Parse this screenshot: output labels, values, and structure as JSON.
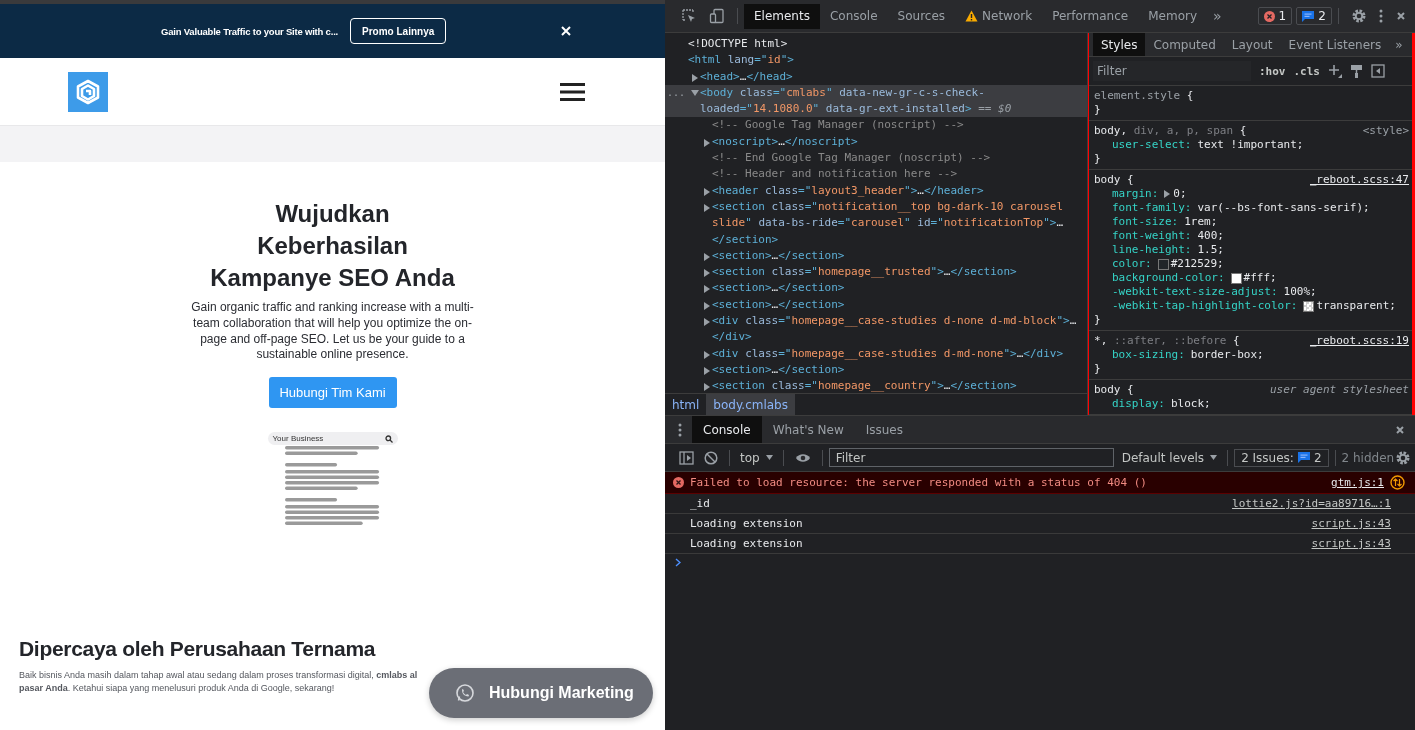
{
  "page": {
    "promo_bar": {
      "text": "Gain Valuable Traffic to your Site with c...",
      "button": "Promo Lainnya"
    },
    "hero": {
      "title_lines": [
        "Wujudkan",
        "Keberhasilan",
        "Kampanye SEO Anda"
      ],
      "description": "Gain organic traffic and ranking increase with a multi-team collaboration that will help you optimize the on-page and off-page SEO. Let us be your guide to a sustainable online presence.",
      "button": "Hubungi Tim Kami",
      "mock_search": "Your Business"
    },
    "trusted": {
      "heading": "Dipercaya oleh Perusahaan Ternama",
      "lines": [
        "Baik bisnis Anda masih dalam tahap awal atau sedang dalam proses transformasi digital, **cmlabs al**",
        "**pasar Anda**. Ketahui siapa yang menelusuri produk Anda di Google, sekarang!"
      ]
    },
    "float_button": "Hubungi Marketing"
  },
  "devtools": {
    "tabs": [
      {
        "label": "Elements",
        "selected": true,
        "warning": false
      },
      {
        "label": "Console",
        "selected": false,
        "warning": false
      },
      {
        "label": "Sources",
        "selected": false,
        "warning": false
      },
      {
        "label": "Network",
        "selected": false,
        "warning": true
      },
      {
        "label": "Performance",
        "selected": false,
        "warning": false
      },
      {
        "label": "Memory",
        "selected": false,
        "warning": false
      }
    ],
    "more_tabs": "»",
    "errors": "1",
    "messages": "2",
    "elements": {
      "tree": [
        {
          "selected": false,
          "segments": [
            {
              "kind": "plain",
              "text": "<!DOCTYPE html>"
            }
          ]
        },
        {
          "selected": false,
          "segments": [
            {
              "kind": "tag",
              "text": "<html "
            },
            {
              "kind": "attr",
              "text": "lang"
            },
            {
              "kind": "tag",
              "text": "=\""
            },
            {
              "kind": "value",
              "text": "id"
            },
            {
              "kind": "tag",
              "text": "\">"
            }
          ],
          "children": [
            {
              "selected": false,
              "expanded": false,
              "segments": [
                {
                  "kind": "tag",
                  "text": "<head>"
                },
                {
                  "kind": "plain",
                  "text": "…"
                },
                {
                  "kind": "tag",
                  "text": "</head>"
                }
              ]
            },
            {
              "selected": true,
              "expanded": true,
              "gutter": "...",
              "segments": [
                {
                  "kind": "tag",
                  "text": "<body "
                },
                {
                  "kind": "attr",
                  "text": "class"
                },
                {
                  "kind": "tag",
                  "text": "=\""
                },
                {
                  "kind": "value",
                  "text": "cmlabs"
                },
                {
                  "kind": "tag",
                  "text": "\" "
                },
                {
                  "kind": "attr",
                  "text": "data-new-gr-c-s-check-loaded"
                },
                {
                  "kind": "tag",
                  "text": "=\""
                },
                {
                  "kind": "value",
                  "text": "14.1080.0"
                },
                {
                  "kind": "tag",
                  "text": "\" "
                },
                {
                  "kind": "attr",
                  "text": "data-gr-ext-installed"
                },
                {
                  "kind": "tag",
                  "text": ">"
                },
                {
                  "kind": "hint",
                  "text": " == $0"
                }
              ],
              "children": [
                {
                  "selected": false,
                  "segments": [
                    {
                      "kind": "comment",
                      "text": "<!-- Google Tag Manager (noscript) -->"
                    }
                  ]
                },
                {
                  "selected": false,
                  "expanded": false,
                  "segments": [
                    {
                      "kind": "tag",
                      "text": "<noscript>"
                    },
                    {
                      "kind": "plain",
                      "text": "…"
                    },
                    {
                      "kind": "tag",
                      "text": "</noscript>"
                    }
                  ]
                },
                {
                  "selected": false,
                  "segments": [
                    {
                      "kind": "comment",
                      "text": "<!-- End Google Tag Manager (noscript) -->"
                    }
                  ]
                },
                {
                  "selected": false,
                  "segments": [
                    {
                      "kind": "comment",
                      "text": "<!-- Header and notification here -->"
                    }
                  ]
                },
                {
                  "selected": false,
                  "expanded": false,
                  "segments": [
                    {
                      "kind": "tag",
                      "text": "<header "
                    },
                    {
                      "kind": "attr",
                      "text": "class"
                    },
                    {
                      "kind": "tag",
                      "text": "=\""
                    },
                    {
                      "kind": "value",
                      "text": "layout3_header"
                    },
                    {
                      "kind": "tag",
                      "text": "\">"
                    },
                    {
                      "kind": "plain",
                      "text": "…"
                    },
                    {
                      "kind": "tag",
                      "text": "</header>"
                    }
                  ]
                },
                {
                  "selected": false,
                  "expanded": false,
                  "segments": [
                    {
                      "kind": "tag",
                      "text": "<section "
                    },
                    {
                      "kind": "attr",
                      "text": "class"
                    },
                    {
                      "kind": "tag",
                      "text": "=\""
                    },
                    {
                      "kind": "value",
                      "text": "notification__top bg-dark-10 carousel slide"
                    },
                    {
                      "kind": "tag",
                      "text": "\" "
                    },
                    {
                      "kind": "attr",
                      "text": "data-bs-ride"
                    },
                    {
                      "kind": "tag",
                      "text": "=\""
                    },
                    {
                      "kind": "value",
                      "text": "carousel"
                    },
                    {
                      "kind": "tag",
                      "text": "\" "
                    },
                    {
                      "kind": "attr",
                      "text": "id"
                    },
                    {
                      "kind": "tag",
                      "text": "=\""
                    },
                    {
                      "kind": "value",
                      "text": "notificationTop"
                    },
                    {
                      "kind": "tag",
                      "text": "\">"
                    },
                    {
                      "kind": "plain",
                      "text": "… "
                    },
                    {
                      "kind": "tag",
                      "text": "</section>"
                    }
                  ]
                },
                {
                  "selected": false,
                  "expanded": false,
                  "segments": [
                    {
                      "kind": "tag",
                      "text": "<section>"
                    },
                    {
                      "kind": "plain",
                      "text": "…"
                    },
                    {
                      "kind": "tag",
                      "text": "</section>"
                    }
                  ]
                },
                {
                  "selected": false,
                  "expanded": false,
                  "segments": [
                    {
                      "kind": "tag",
                      "text": "<section "
                    },
                    {
                      "kind": "attr",
                      "text": "class"
                    },
                    {
                      "kind": "tag",
                      "text": "=\""
                    },
                    {
                      "kind": "value",
                      "text": "homepage__trusted"
                    },
                    {
                      "kind": "tag",
                      "text": "\">"
                    },
                    {
                      "kind": "plain",
                      "text": "…"
                    },
                    {
                      "kind": "tag",
                      "text": "</section>"
                    }
                  ]
                },
                {
                  "selected": false,
                  "expanded": false,
                  "segments": [
                    {
                      "kind": "tag",
                      "text": "<section>"
                    },
                    {
                      "kind": "plain",
                      "text": "…"
                    },
                    {
                      "kind": "tag",
                      "text": "</section>"
                    }
                  ]
                },
                {
                  "selected": false,
                  "expanded": false,
                  "segments": [
                    {
                      "kind": "tag",
                      "text": "<section>"
                    },
                    {
                      "kind": "plain",
                      "text": "…"
                    },
                    {
                      "kind": "tag",
                      "text": "</section>"
                    }
                  ]
                },
                {
                  "selected": false,
                  "expanded": false,
                  "segments": [
                    {
                      "kind": "tag",
                      "text": "<div "
                    },
                    {
                      "kind": "attr",
                      "text": "class"
                    },
                    {
                      "kind": "tag",
                      "text": "=\""
                    },
                    {
                      "kind": "value",
                      "text": "homepage__case-studies d-none d-md-block"
                    },
                    {
                      "kind": "tag",
                      "text": "\">"
                    },
                    {
                      "kind": "plain",
                      "text": "… "
                    },
                    {
                      "kind": "tag",
                      "text": "</div>"
                    }
                  ]
                },
                {
                  "selected": false,
                  "expanded": false,
                  "segments": [
                    {
                      "kind": "tag",
                      "text": "<div "
                    },
                    {
                      "kind": "attr",
                      "text": "class"
                    },
                    {
                      "kind": "tag",
                      "text": "=\""
                    },
                    {
                      "kind": "value",
                      "text": "homepage__case-studies d-md-none"
                    },
                    {
                      "kind": "tag",
                      "text": "\">"
                    },
                    {
                      "kind": "plain",
                      "text": "…"
                    },
                    {
                      "kind": "tag",
                      "text": "</div>"
                    }
                  ]
                },
                {
                  "selected": false,
                  "expanded": false,
                  "segments": [
                    {
                      "kind": "tag",
                      "text": "<section>"
                    },
                    {
                      "kind": "plain",
                      "text": "…"
                    },
                    {
                      "kind": "tag",
                      "text": "</section>"
                    }
                  ]
                },
                {
                  "selected": false,
                  "expanded": false,
                  "segments": [
                    {
                      "kind": "tag",
                      "text": "<section "
                    },
                    {
                      "kind": "attr",
                      "text": "class"
                    },
                    {
                      "kind": "tag",
                      "text": "=\""
                    },
                    {
                      "kind": "value",
                      "text": "homepage__country"
                    },
                    {
                      "kind": "tag",
                      "text": "\">"
                    },
                    {
                      "kind": "plain",
                      "text": "…"
                    },
                    {
                      "kind": "tag",
                      "text": "</section>"
                    }
                  ]
                }
              ]
            }
          ]
        }
      ],
      "breadcrumbs": [
        {
          "label": "html",
          "selected": false
        },
        {
          "label": "body.cmlabs",
          "selected": true
        }
      ]
    },
    "styles": {
      "highlighted": true,
      "tabs": [
        {
          "label": "Styles",
          "selected": true
        },
        {
          "label": "Computed",
          "selected": false
        },
        {
          "label": "Layout",
          "selected": false
        },
        {
          "label": "Event Listeners",
          "selected": false
        }
      ],
      "more_tabs": "»",
      "filter_placeholder": "Filter",
      "hov": ":hov",
      "cls": ".cls",
      "rules": [
        {
          "selector": [
            {
              "kind": "dim",
              "text": "element.style"
            },
            {
              "kind": "brace",
              "text": " {"
            }
          ],
          "close": "}"
        },
        {
          "selector": [
            {
              "kind": "match",
              "text": "body"
            },
            {
              "kind": "brace",
              "text": ", "
            },
            {
              "kind": "dim",
              "text": "div, a, p, span"
            },
            {
              "kind": "brace",
              "text": " {"
            }
          ],
          "source": {
            "kind": "style",
            "text": "<style>"
          },
          "properties": [
            {
              "name": "user-select:",
              "value": "text !important;"
            }
          ],
          "close": "}"
        },
        {
          "selector": [
            {
              "kind": "match",
              "text": "body"
            },
            {
              "kind": "brace",
              "text": " {"
            }
          ],
          "source": {
            "kind": "link",
            "text": "_reboot.scss:47"
          },
          "properties": [
            {
              "name": "margin:",
              "value": "0;",
              "expandable": true
            },
            {
              "name": "font-family:",
              "value": "var(--bs-font-sans-serif);"
            },
            {
              "name": "font-size:",
              "value": "1rem;"
            },
            {
              "name": "font-weight:",
              "value": "400;"
            },
            {
              "name": "line-height:",
              "value": "1.5;"
            },
            {
              "name": "color:",
              "value": "#212529;",
              "swatch": true
            },
            {
              "name": "background-color:",
              "value": "#fff;",
              "swatch": true
            },
            {
              "name": "-webkit-text-size-adjust:",
              "value": "100%;"
            },
            {
              "name": "-webkit-tap-highlight-color:",
              "value": "transparent;",
              "swatch": true
            }
          ],
          "close": "}"
        },
        {
          "selector": [
            {
              "kind": "match",
              "text": "*"
            },
            {
              "kind": "brace",
              "text": ", "
            },
            {
              "kind": "dim",
              "text": "::after, ::before"
            },
            {
              "kind": "brace",
              "text": " {"
            }
          ],
          "source": {
            "kind": "link",
            "text": "_reboot.scss:19"
          },
          "properties": [
            {
              "name": "box-sizing:",
              "value": "border-box;"
            }
          ],
          "close": "}"
        },
        {
          "selector": [
            {
              "kind": "match",
              "text": "body"
            },
            {
              "kind": "brace",
              "text": " {"
            }
          ],
          "source": {
            "kind": "ua",
            "text": "user agent stylesheet"
          },
          "properties": [
            {
              "name": "display:",
              "value": "block;"
            }
          ]
        }
      ]
    },
    "drawer": {
      "tabs": [
        {
          "label": "Console",
          "selected": true
        },
        {
          "label": "What's New",
          "selected": false
        },
        {
          "label": "Issues",
          "selected": false
        }
      ],
      "context": "top",
      "filter_placeholder": "Filter",
      "levels": "Default levels",
      "issues_label": "2 Issues:",
      "issues_count": "2",
      "hidden": "2 hidden",
      "messages": [
        {
          "kind": "error",
          "text": "Failed to load resource: the server responded with a status of 404 ()",
          "source": "gtm.js:1"
        },
        {
          "kind": "log",
          "text": "_id",
          "source": "lottie2.js?id=aa89716…:1"
        },
        {
          "kind": "log",
          "text": "Loading extension",
          "source": "script.js:43"
        },
        {
          "kind": "log",
          "text": "Loading extension",
          "source": "script.js:43"
        }
      ]
    }
  }
}
